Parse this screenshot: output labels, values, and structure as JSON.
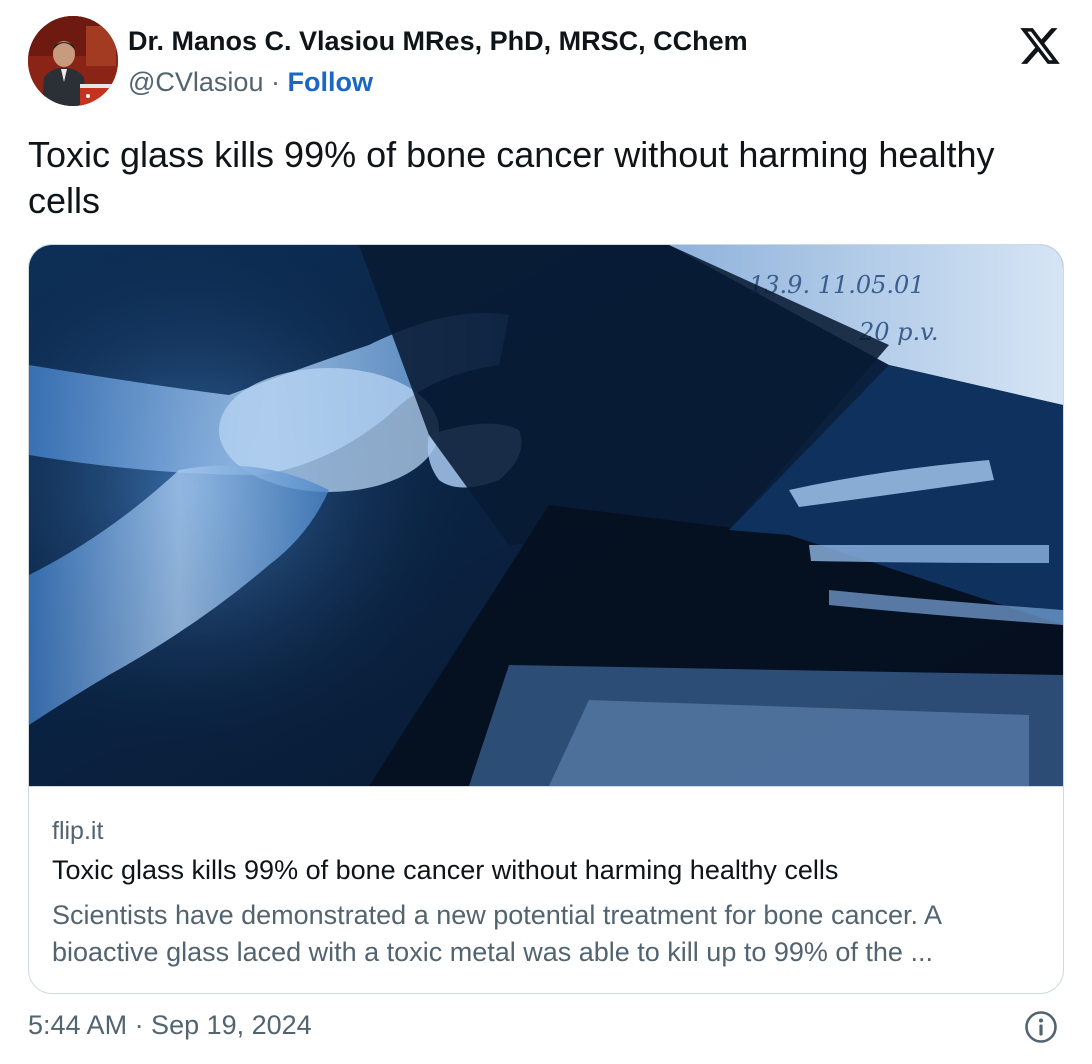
{
  "author": {
    "name": "Dr. Manos C. Vlasiou MRes, PhD, MRSC, CChem",
    "handle": "@CVlasiou",
    "separator": " · ",
    "follow_label": "Follow"
  },
  "post": {
    "text": "Toxic glass kills 99% of bone cancer without harming healthy cells",
    "timestamp": "5:44 AM · Sep 19, 2024"
  },
  "link_card": {
    "domain": "flip.it",
    "title": "Toxic glass kills 99% of bone cancer without harming healthy cells",
    "description_line1": "Scientists have demonstrated a new potential treatment for bone cancer. A",
    "description_line2": "bioactive glass laced with a toxic metal was able to kill up to 99% of the ...",
    "image_handwriting_line1": "13.9.   11.05.01",
    "image_handwriting_line2": "20 p.v."
  },
  "icons": {
    "brand": "x-logo-icon",
    "info": "info-icon"
  },
  "colors": {
    "link_blue": "#1d67c4",
    "secondary_text": "#536471",
    "primary_text": "#0f1419",
    "border": "#cfd9de"
  }
}
